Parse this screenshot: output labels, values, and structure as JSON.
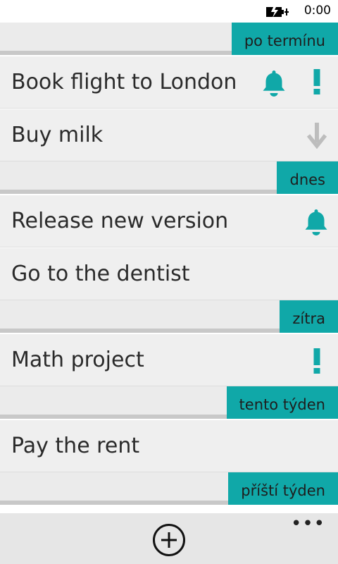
{
  "status_bar": {
    "time": "0:00",
    "battery_icon": "battery-charging-icon"
  },
  "sections": [
    {
      "label": "po termínu",
      "tasks": [
        {
          "title": "Book flight to London",
          "icons": [
            "bell-icon",
            "exclamation-icon"
          ]
        },
        {
          "title": "Buy milk",
          "icons": [
            "arrow-down-icon"
          ]
        }
      ]
    },
    {
      "label": "dnes",
      "tasks": [
        {
          "title": "Release new version",
          "icons": [
            "bell-icon"
          ]
        },
        {
          "title": "Go to the dentist",
          "icons": []
        }
      ]
    },
    {
      "label": "zítra",
      "tasks": [
        {
          "title": "Math project",
          "icons": [
            "exclamation-icon"
          ]
        }
      ]
    },
    {
      "label": "tento týden",
      "tasks": [
        {
          "title": "Pay the rent",
          "icons": []
        }
      ]
    },
    {
      "label": "příští týden",
      "tasks": []
    }
  ],
  "app_bar": {
    "add_icon": "add-circle-icon",
    "more_label": "•••"
  },
  "colors": {
    "accent": "#10a8a8",
    "low_priority_gray": "#bdbdbd"
  }
}
